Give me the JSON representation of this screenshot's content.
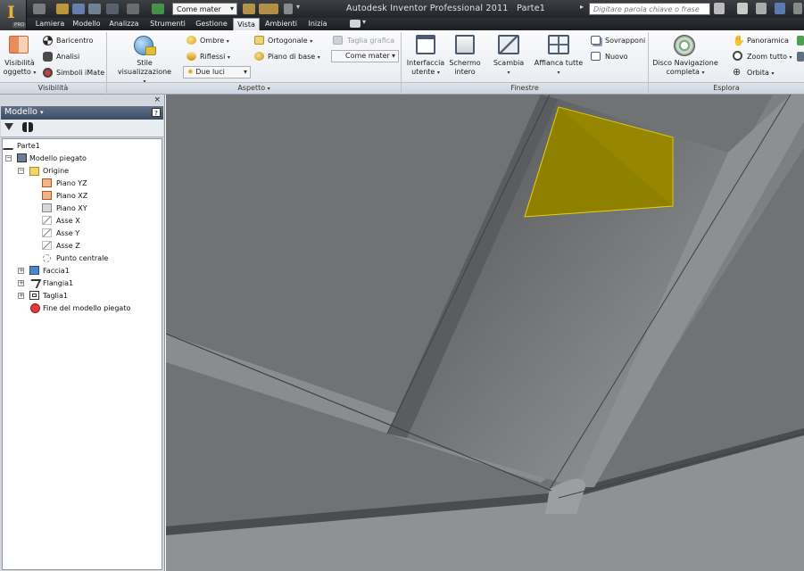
{
  "app": {
    "title": "Autodesk Inventor Professional 2011",
    "document": "Parte1",
    "pro_badge": "PRO"
  },
  "quick_access": {
    "material_combo": "Come mater"
  },
  "search": {
    "placeholder": "Digitare parola chiave o frase"
  },
  "tabs": [
    "Lamiera",
    "Modello",
    "Analizza",
    "Strumenti",
    "Gestione",
    "Vista",
    "Ambienti",
    "Inizia"
  ],
  "active_tab": "Vista",
  "ribbon": {
    "visibilita": {
      "panel_label": "Visibilità",
      "visibilita_oggetto": [
        "Visibilità",
        "oggetto"
      ],
      "baricentro": "Baricentro",
      "analisi": "Analisi",
      "simboli_imate": "Simboli iMate"
    },
    "aspetto": {
      "panel_label": "Aspetto",
      "stile_visualizzazione": "Stile visualizzazione",
      "ombre": "Ombre",
      "riflessi": "Riflessi",
      "due_luci": "Due luci",
      "ortogonale": "Ortogonale",
      "piano_di_base": "Piano di base",
      "taglia_grafica": "Taglia grafica",
      "come_materiale": "Come mater"
    },
    "finestre": {
      "panel_label": "Finestre",
      "interfaccia_utente": [
        "Interfaccia",
        "utente"
      ],
      "schermo_intero": [
        "Schermo",
        "intero"
      ],
      "scambia": "Scambia",
      "affianca_tutte": "Affianca tutte",
      "sovrapponi": "Sovrapponi",
      "nuovo": "Nuovo"
    },
    "esplora": {
      "panel_label": "Esplora",
      "disco_navigazione": [
        "Disco Navigazione",
        "completa"
      ],
      "panoramica": "Panoramica",
      "zoom_tutto": "Zoom tutto",
      "orbita": "Orbita"
    }
  },
  "browser": {
    "title": "Modello",
    "help": "?",
    "tree": [
      {
        "label": "Parte1",
        "icon": "part-icon"
      },
      {
        "label": "Modello piegato",
        "icon": "folded-model-icon"
      },
      {
        "label": "Origine",
        "icon": "folder-icon"
      },
      {
        "label": "Piano YZ",
        "icon": "plane-icon"
      },
      {
        "label": "Piano XZ",
        "icon": "plane-icon"
      },
      {
        "label": "Piano XY",
        "icon": "plane-icon"
      },
      {
        "label": "Asse X",
        "icon": "axis-icon"
      },
      {
        "label": "Asse Y",
        "icon": "axis-icon"
      },
      {
        "label": "Asse Z",
        "icon": "axis-icon"
      },
      {
        "label": "Punto centrale",
        "icon": "point-icon"
      },
      {
        "label": "Faccia1",
        "icon": "face-icon"
      },
      {
        "label": "Flangia1",
        "icon": "flange-icon"
      },
      {
        "label": "Taglia1",
        "icon": "cut-icon"
      },
      {
        "label": "Fine del modello piegato",
        "icon": "end-of-part-icon"
      }
    ]
  },
  "colors": {
    "highlight_face": "#d9c200",
    "titlebar": "#2a2d31",
    "browser_header": "#4a5a72"
  }
}
